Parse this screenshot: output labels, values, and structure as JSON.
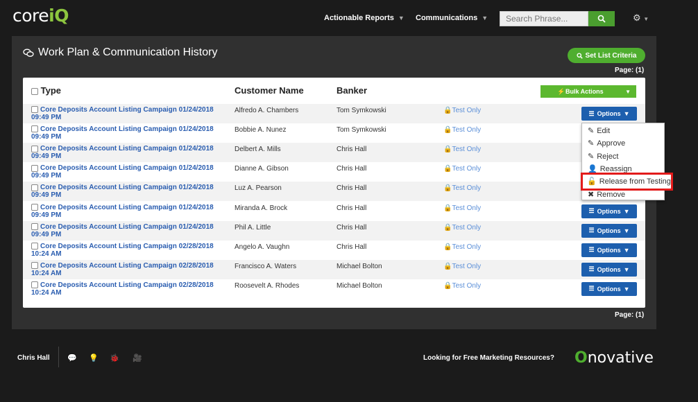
{
  "brand": {
    "core": "core",
    "iq": "iQ"
  },
  "nav": {
    "reports": "Actionable Reports",
    "communications": "Communications",
    "search_placeholder": "Search Phrase..."
  },
  "page": {
    "title": "Work Plan & Communication History",
    "set_criteria": "Set List Criteria",
    "page_label_top": "Page: (1)",
    "page_label_bottom": "Page: (1)"
  },
  "table": {
    "headers": {
      "type": "Type",
      "customer": "Customer Name",
      "banker": "Banker"
    },
    "bulk_actions": "Bulk Actions",
    "options_label": "Options",
    "rows": [
      {
        "campaign": "Core Deposits Account Listing Campaign 01/24/2018",
        "time": "09:49 PM",
        "customer": "Alfredo A. Chambers",
        "banker": "Tom Symkowski",
        "status": "Test Only"
      },
      {
        "campaign": "Core Deposits Account Listing Campaign 01/24/2018",
        "time": "09:49 PM",
        "customer": "Bobbie A. Nunez",
        "banker": "Tom Symkowski",
        "status": "Test Only"
      },
      {
        "campaign": "Core Deposits Account Listing Campaign 01/24/2018",
        "time": "09:49 PM",
        "customer": "Delbert A. Mills",
        "banker": "Chris Hall",
        "status": "Test Only"
      },
      {
        "campaign": "Core Deposits Account Listing Campaign 01/24/2018",
        "time": "09:49 PM",
        "customer": "Dianne A. Gibson",
        "banker": "Chris Hall",
        "status": "Test Only"
      },
      {
        "campaign": "Core Deposits Account Listing Campaign 01/24/2018",
        "time": "09:49 PM",
        "customer": "Luz A. Pearson",
        "banker": "Chris Hall",
        "status": "Test Only"
      },
      {
        "campaign": "Core Deposits Account Listing Campaign 01/24/2018",
        "time": "09:49 PM",
        "customer": "Miranda A. Brock",
        "banker": "Chris Hall",
        "status": "Test Only"
      },
      {
        "campaign": "Core Deposits Account Listing Campaign 01/24/2018",
        "time": "09:49 PM",
        "customer": "Phil A. Little",
        "banker": "Chris Hall",
        "status": "Test Only"
      },
      {
        "campaign": "Core Deposits Account Listing Campaign 02/28/2018",
        "time": "10:24 AM",
        "customer": "Angelo A. Vaughn",
        "banker": "Chris Hall",
        "status": "Test Only"
      },
      {
        "campaign": "Core Deposits Account Listing Campaign 02/28/2018",
        "time": "10:24 AM",
        "customer": "Francisco A. Waters",
        "banker": "Michael Bolton",
        "status": "Test Only"
      },
      {
        "campaign": "Core Deposits Account Listing Campaign 02/28/2018",
        "time": "10:24 AM",
        "customer": "Roosevelt A. Rhodes",
        "banker": "Michael Bolton",
        "status": "Test Only"
      }
    ]
  },
  "dropdown": {
    "edit": "Edit",
    "approve": "Approve",
    "reject": "Reject",
    "reassign": "Reassign",
    "release": "Release from Testing",
    "remove": "Remove"
  },
  "footer": {
    "user": "Chris Hall",
    "resources": "Looking for Free Marketing Resources?",
    "logo_o": "O",
    "logo_rest": "novative"
  },
  "colors": {
    "accent_green": "#4fae2f",
    "link_blue": "#2a5db0",
    "options_blue": "#1d5fae",
    "highlight_red": "#e31b1b"
  }
}
